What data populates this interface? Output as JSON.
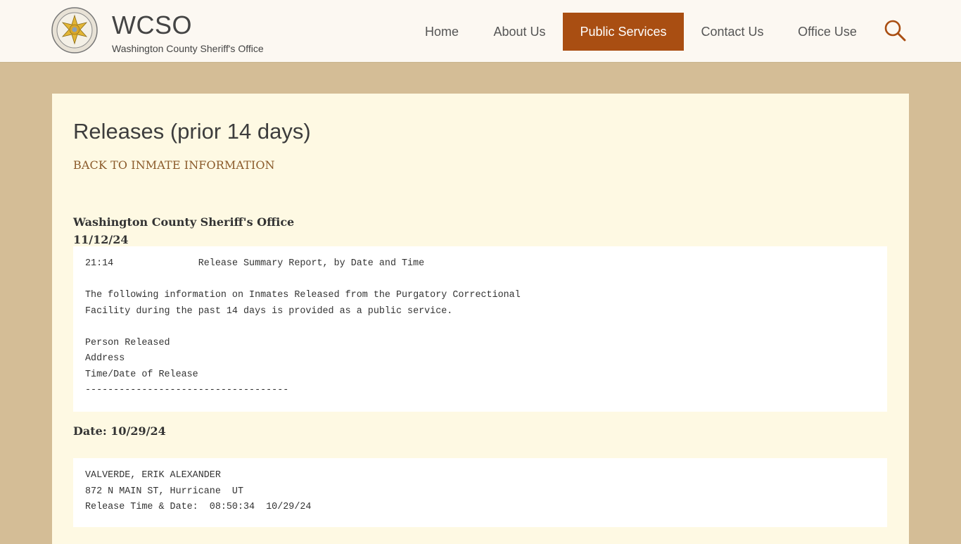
{
  "header": {
    "title": "WCSO",
    "subtitle": "Washington County Sheriff's Office",
    "logo_text": "WASHINGTON COUNTY SHERIFF",
    "nav": [
      {
        "label": "Home",
        "active": false
      },
      {
        "label": "About Us",
        "active": false
      },
      {
        "label": "Public Services",
        "active": true
      },
      {
        "label": "Contact Us",
        "active": false
      },
      {
        "label": "Office Use",
        "active": false
      }
    ],
    "search_icon": "search-icon"
  },
  "colors": {
    "page_bg": "#d4bd96",
    "header_bg": "#fcf8f2",
    "card_bg": "#fef9e3",
    "accent": "#a94e12",
    "link": "#8a5a2a"
  },
  "main": {
    "title": "Releases (prior 14 days)",
    "back_link": "BACK TO INMATE INFORMATION",
    "org_name": "Washington County Sheriff's Office",
    "report_date": "11/12/24",
    "report_header": {
      "time": "21:14",
      "report_title": "Release Summary Report, by Date and Time",
      "intro_line1": "The following information on Inmates Released from the Purgatory Correctional",
      "intro_line2": "Facility during the past 14 days is provided as a public service.",
      "legend_person": "Person Released",
      "legend_address": "Address",
      "legend_time": "Time/Date of Release",
      "divider": "------------------------------------"
    },
    "date_group": {
      "label": "Date: 10/29/24",
      "entries": [
        {
          "name": "VALVERDE, ERIK ALEXANDER",
          "address": "872 N MAIN ST, Hurricane  UT",
          "release": "Release Time & Date:  08:50:34  10/29/24"
        }
      ]
    }
  }
}
